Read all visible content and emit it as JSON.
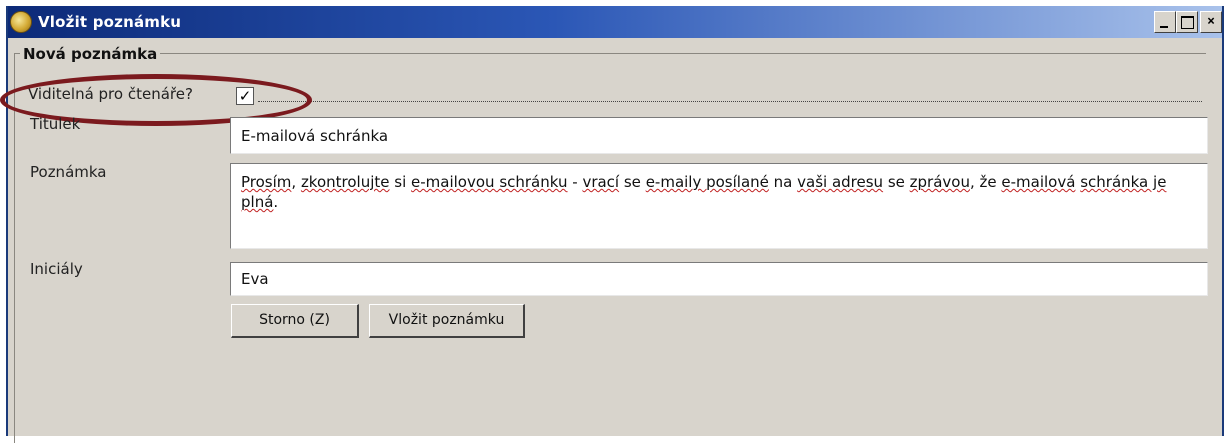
{
  "window": {
    "title": "Vložit poznámku",
    "controls": {
      "minimize": "_",
      "maximize": "□",
      "close": "×"
    }
  },
  "group": {
    "legend": "Nová poznámka"
  },
  "form": {
    "visible_label": "Viditelná pro čtenáře?",
    "visible_checked": true,
    "visible_check_glyph": "✓",
    "title_label": "Titulek",
    "title_value": "E-mailová schránka",
    "note_label": "Poznámka",
    "note_value_parts": [
      "Prosím",
      ", ",
      "zkontrolujte",
      " si ",
      "e-mailovou schránku",
      " - ",
      "vrací",
      " se ",
      "e-maily posílané",
      " na ",
      "vaši adresu",
      " se ",
      "zprávou",
      ", že ",
      "e-mailová",
      " ",
      "schránka je plná",
      "."
    ],
    "initials_label": "Iniciály",
    "initials_value": "Eva"
  },
  "buttons": {
    "cancel": "Storno (Z)",
    "insert": "Vložit poznámku"
  },
  "colors": {
    "highlight_ellipse": "#7b1a1e",
    "titlebar_start": "#0c2a78",
    "titlebar_end": "#a9c2eb",
    "window_bg": "#d8d4cc"
  },
  "icons": {
    "app": "globe-icon"
  }
}
